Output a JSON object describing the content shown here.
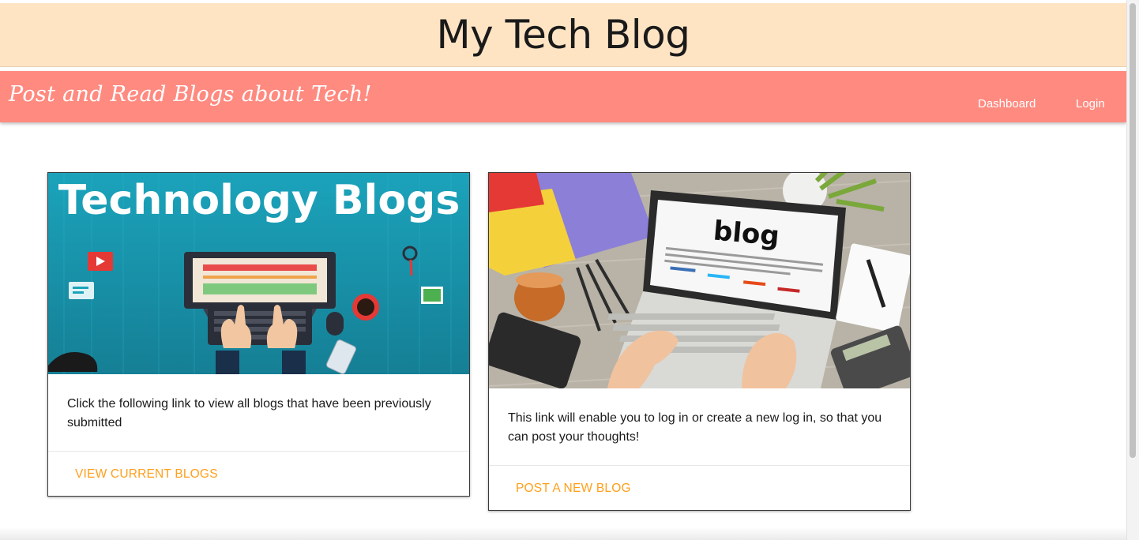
{
  "header": {
    "title": "My Tech Blog"
  },
  "navbar": {
    "tagline": "Post and Read Blogs about Tech!",
    "links": {
      "dashboard": "Dashboard",
      "login": "Login"
    }
  },
  "cards": [
    {
      "image_text": "Technology Blogs",
      "text": "Click the following link to view all blogs that have been previously submitted",
      "action": "VIEW CURRENT BLOGS"
    },
    {
      "image_text": "blog",
      "text": "This link will enable you to log in or create a new log in, so that you can post your thoughts!",
      "action": "POST A NEW BLOG"
    }
  ],
  "colors": {
    "header_bg": "#ffe4c4",
    "navbar_bg": "#ff8a80",
    "action_link": "#ff9f1a",
    "card1_image_bg": "#1f9eb5"
  }
}
